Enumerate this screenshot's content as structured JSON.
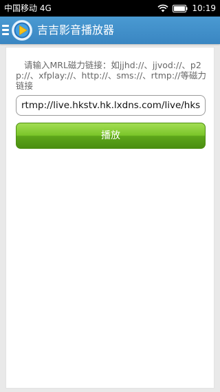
{
  "status_bar": {
    "carrier": "中国移动 4G",
    "time": "10:19",
    "icons": [
      "wifi-icon",
      "battery-icon"
    ]
  },
  "title_bar": {
    "title": "吉吉影音播放器",
    "icons": [
      "menu-icon",
      "app-logo-icon"
    ],
    "background_color": "#3a8fcc"
  },
  "form": {
    "hint": "请输入MRL磁力链接：如jjhd://、jjvod://、p2p://、xfplay://、http://、sms://、rtmp://等磁力链接",
    "url_value": "rtmp://live.hkstv.hk.lxdns.com/live/hks",
    "play_label": "播放",
    "play_button_color": "#6cb61f"
  }
}
